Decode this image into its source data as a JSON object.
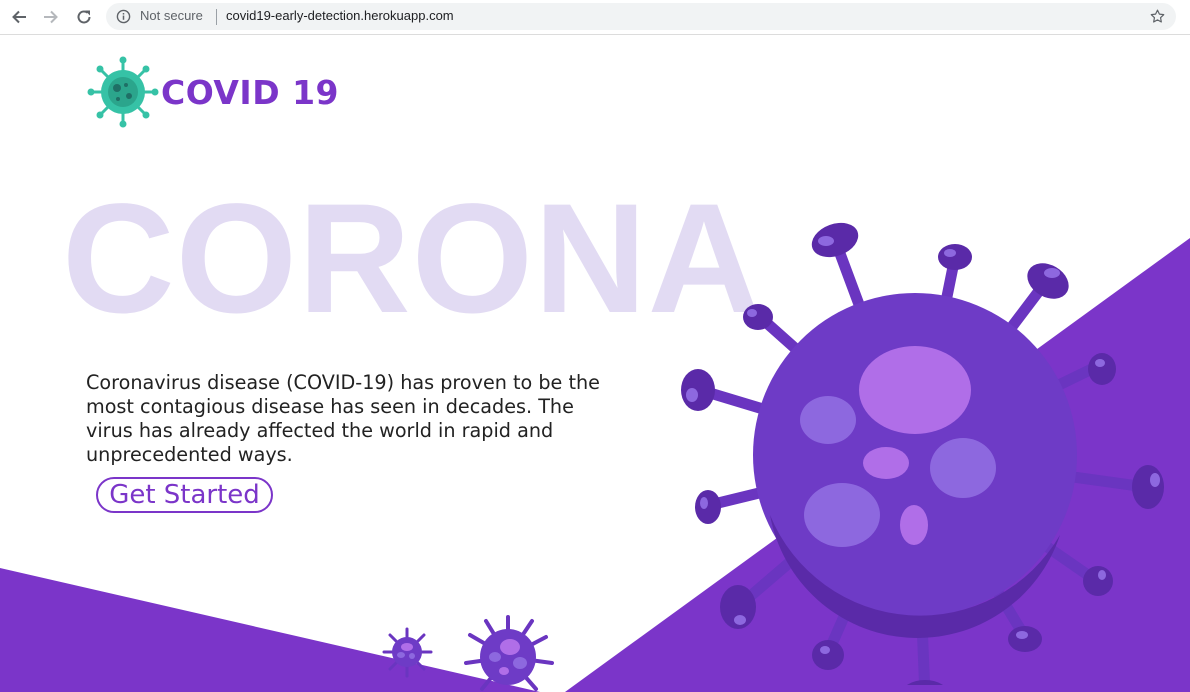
{
  "browser": {
    "security_label": "Not secure",
    "url": "covid19-early-detection.herokuapp.com"
  },
  "header": {
    "logo_text": "COVID 19"
  },
  "hero": {
    "background_word": "CORONA",
    "description": "Coronavirus disease (COVID-19) has proven to be the most contagious disease has seen in decades. The virus has already affected the world in rapid and unprecedented ways.",
    "cta_label": "Get Started"
  },
  "colors": {
    "brand_purple": "#7b35c9",
    "logo_teal": "#36c2a6",
    "watermark": "#e2dbf3"
  },
  "icons": [
    "back-arrow-icon",
    "forward-arrow-icon",
    "reload-icon",
    "info-icon",
    "star-icon",
    "virus-logo-icon",
    "virus-illustration"
  ]
}
